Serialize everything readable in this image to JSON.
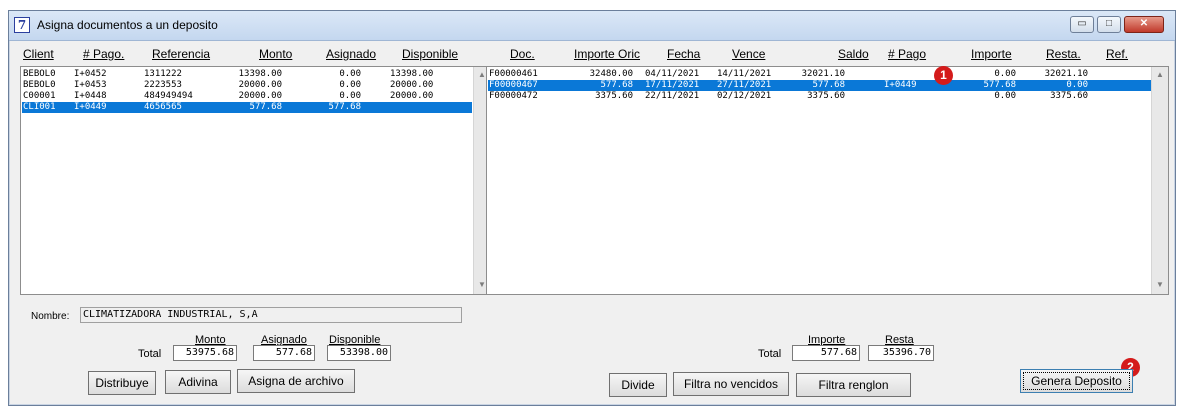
{
  "window": {
    "title": "Asigna documentos a un deposito",
    "icon_glyph": "7",
    "icon": "app-icon",
    "controls": {
      "minimize": "▭",
      "maximize": "□",
      "close": "✕"
    }
  },
  "left_list": {
    "headers": [
      "Client",
      "# Pago.",
      "Referencia",
      "Monto",
      "Asignado",
      "Disponible"
    ],
    "rows": [
      {
        "client": "BEBOL0",
        "pago": "I+0452",
        "referencia": "1311222",
        "monto": "13398.00",
        "asignado": "0.00",
        "disponible": "13398.00",
        "selected": false
      },
      {
        "client": "BEBOL0",
        "pago": "I+0453",
        "referencia": "2223553",
        "monto": "20000.00",
        "asignado": "0.00",
        "disponible": "20000.00",
        "selected": false
      },
      {
        "client": "C00001",
        "pago": "I+0448",
        "referencia": "484949494",
        "monto": "20000.00",
        "asignado": "0.00",
        "disponible": "20000.00",
        "selected": false
      },
      {
        "client": "CLI001",
        "pago": "I+0449",
        "referencia": "4656565",
        "monto": "577.68",
        "asignado": "577.68",
        "disponible": "",
        "selected": true
      }
    ]
  },
  "right_list": {
    "headers": [
      "Doc.",
      "Importe Oric",
      "Fecha",
      "Vence",
      "Saldo",
      "# Pago",
      "Importe",
      "Resta.",
      "Ref."
    ],
    "rows": [
      {
        "doc": "F00000461",
        "importe_orig": "32480.00",
        "fecha": "04/11/2021",
        "vence": "14/11/2021",
        "saldo": "32021.10",
        "pago": "",
        "importe": "0.00",
        "resta": "32021.10",
        "ref": "",
        "selected": false
      },
      {
        "doc": "F00000467",
        "importe_orig": "577.68",
        "fecha": "17/11/2021",
        "vence": "27/11/2021",
        "saldo": "577.68",
        "pago": "I+0449",
        "importe": "577.68",
        "resta": "0.00",
        "ref": "",
        "selected": true
      },
      {
        "doc": "F00000472",
        "importe_orig": "3375.60",
        "fecha": "22/11/2021",
        "vence": "02/12/2021",
        "saldo": "3375.60",
        "pago": "",
        "importe": "0.00",
        "resta": "3375.60",
        "ref": "",
        "selected": false
      }
    ]
  },
  "scroll": {
    "up": "▲",
    "down": "▼"
  },
  "nombre": {
    "label": "Nombre:",
    "value": "CLIMATIZADORA INDUSTRIAL, S,A"
  },
  "left_totals": {
    "total_label": "Total",
    "monto_label": "Monto",
    "asignado_label": "Asignado",
    "disponible_label": "Disponible",
    "monto": "53975.68",
    "asignado": "577.68",
    "disponible": "53398.00"
  },
  "right_totals": {
    "total_label": "Total",
    "importe_label": "Importe",
    "resta_label": "Resta",
    "importe": "577.68",
    "resta": "35396.70"
  },
  "buttons": {
    "distribuye": "Distribuye",
    "adivina": "Adivina",
    "asigna_archivo": "Asigna de archivo",
    "divide": "Divide",
    "filtra_no_vencidos": "Filtra no vencidos",
    "filtra_renglon": "Filtra renglon",
    "genera_deposito": "Genera Deposito"
  },
  "badges": {
    "one": "1",
    "two": "2"
  },
  "colors": {
    "selection": "#0a78d7",
    "badge": "#d41b1b"
  }
}
